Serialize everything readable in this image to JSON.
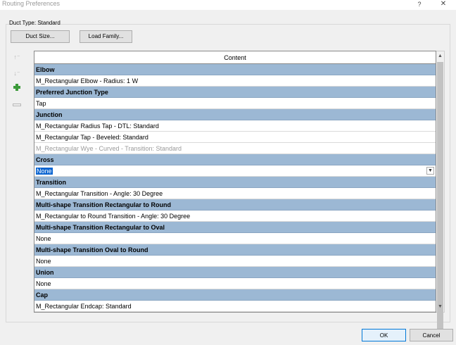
{
  "window": {
    "title": "Routing Preferences",
    "help": "?",
    "close": "✕"
  },
  "duct_type_label": "Duct Type: Standard",
  "toolbar": {
    "duct_size": "Duct Size...",
    "load_family": "Load Family..."
  },
  "side_icons": {
    "move_up": "↑⁻",
    "move_down": "↓⁻"
  },
  "grid": {
    "header": "Content",
    "rows": [
      {
        "type": "group",
        "text": "Elbow"
      },
      {
        "type": "item",
        "text": "M_Rectangular Elbow - Radius: 1 W"
      },
      {
        "type": "group",
        "text": "Preferred Junction Type"
      },
      {
        "type": "item",
        "text": "Tap"
      },
      {
        "type": "group",
        "text": "Junction"
      },
      {
        "type": "item",
        "text": "M_Rectangular Radius Tap - DTL: Standard"
      },
      {
        "type": "item",
        "text": "M_Rectangular Tap - Beveled: Standard"
      },
      {
        "type": "disabled",
        "text": "M_Rectangular Wye - Curved - Transition: Standard"
      },
      {
        "type": "group",
        "text": "Cross"
      },
      {
        "type": "selected",
        "text": "None"
      },
      {
        "type": "group",
        "text": "Transition"
      },
      {
        "type": "item",
        "text": "M_Rectangular Transition - Angle: 30 Degree"
      },
      {
        "type": "group",
        "text": "Multi-shape Transition Rectangular to Round"
      },
      {
        "type": "item",
        "text": "M_Rectangular to Round Transition - Angle: 30 Degree"
      },
      {
        "type": "group",
        "text": "Multi-shape Transition Rectangular to Oval"
      },
      {
        "type": "item",
        "text": "None"
      },
      {
        "type": "group",
        "text": "Multi-shape Transition Oval to Round"
      },
      {
        "type": "item",
        "text": "None"
      },
      {
        "type": "group",
        "text": "Union"
      },
      {
        "type": "item",
        "text": "None"
      },
      {
        "type": "group",
        "text": "Cap"
      },
      {
        "type": "item",
        "text": "M_Rectangular Endcap: Standard"
      }
    ]
  },
  "scroll": {
    "up": "▲",
    "down": "▼"
  },
  "footer": {
    "ok": "OK",
    "cancel": "Cancel"
  },
  "colors": {
    "group_bg": "#9cb8d4",
    "selection": "#0a64d0",
    "plus_icon": "#3c9a3a"
  }
}
